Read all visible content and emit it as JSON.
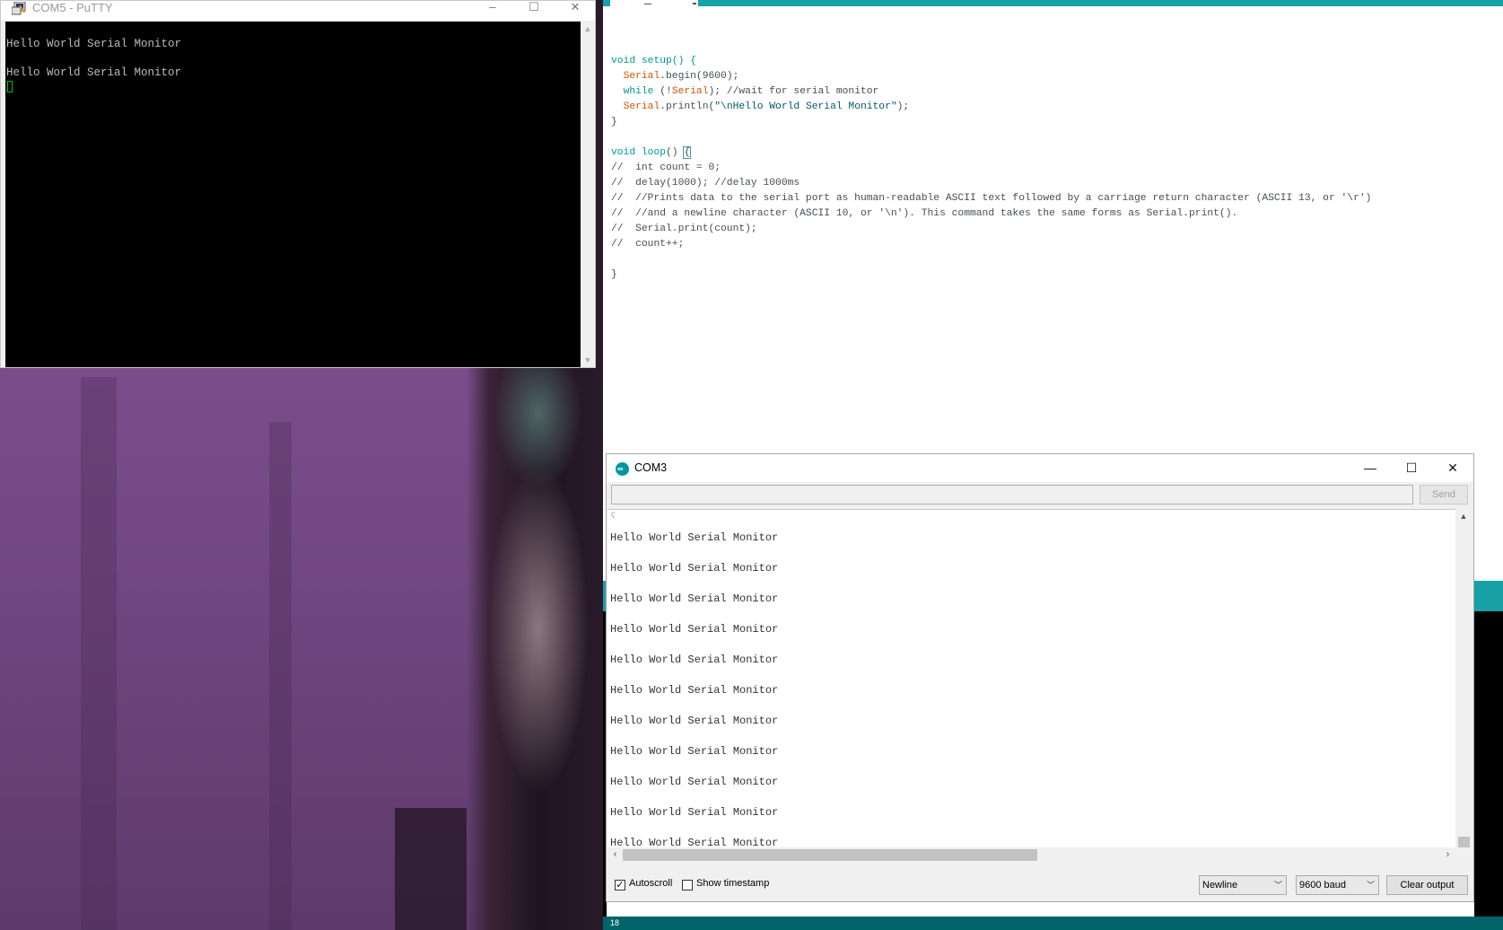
{
  "putty": {
    "title": "COM5 - PuTTY",
    "terminal_lines": [
      "Hello World Serial Monitor",
      "",
      "Hello World Serial Monitor"
    ],
    "controls": {
      "minimize": "–",
      "maximize": "☐",
      "close": "✕"
    }
  },
  "ide": {
    "code": {
      "l1": "void setup() {",
      "l2_fn": "Serial",
      "l2_rest": ".begin(9600);",
      "l3_kw": "while",
      "l3_mid": " (!",
      "l3_fn": "Serial",
      "l3_rest": "); ",
      "l3_cm": "//wait for serial monitor",
      "l4_fn": "Serial",
      "l4_rest": ".println(",
      "l4_str": "\"\\nHello World Serial Monitor\"",
      "l4_end": ");",
      "l5": "}",
      "l7_kw": "void",
      "l7_fn": "loop",
      "l7_rest": "() ",
      "l7_brace": "{",
      "c1": "//  int count = 0;",
      "c2": "//  delay(1000); //delay 1000ms",
      "c3": "//  //Prints data to the serial port as human-readable ASCII text followed by a carriage return character (ASCII 13, or '\\r')",
      "c4": "//  //and a newline character (ASCII 10, or '\\n'). This command takes the same forms as Serial.print().",
      "c5": "//  Serial.print(count);",
      "c6": "//  count++;",
      "close": "}"
    },
    "status_text": "18"
  },
  "com3": {
    "title": "COM3",
    "controls": {
      "minimize": "—",
      "maximize": "☐",
      "close": "✕"
    },
    "input_value": "",
    "send_label": "Send",
    "output_top_glyph": "ʕ",
    "output_lines": [
      "Hello World Serial Monitor",
      "Hello World Serial Monitor",
      "Hello World Serial Monitor",
      "Hello World Serial Monitor",
      "Hello World Serial Monitor",
      "Hello World Serial Monitor",
      "Hello World Serial Monitor",
      "Hello World Serial Monitor",
      "Hello World Serial Monitor",
      "Hello World Serial Monitor",
      "Hello World Serial Monitor"
    ],
    "autoscroll_label": "Autoscroll",
    "autoscroll_checked": true,
    "timestamp_label": "Show timestamp",
    "timestamp_checked": false,
    "line_ending": "Newline",
    "baud_rate": "9600 baud",
    "clear_label": "Clear output",
    "brand_color": "#00979c"
  }
}
